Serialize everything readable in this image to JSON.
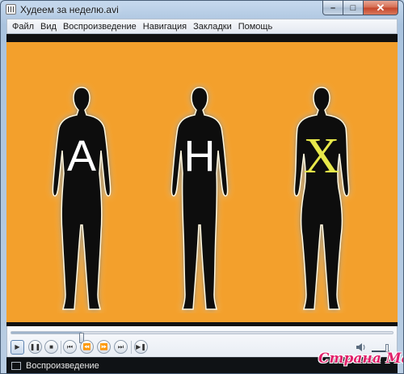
{
  "window": {
    "title": "Худеем за неделю.avi"
  },
  "menu": {
    "items": [
      {
        "label": "Файл"
      },
      {
        "label": "Вид"
      },
      {
        "label": "Воспроизведение"
      },
      {
        "label": "Навигация"
      },
      {
        "label": "Закладки"
      },
      {
        "label": "Помощь"
      }
    ]
  },
  "video": {
    "background": "#f3a02c",
    "letters": [
      {
        "text": "А",
        "color": "#ffffff"
      },
      {
        "text": "Н",
        "color": "#ffffff"
      },
      {
        "text": "Х",
        "color": "#e7e84a"
      }
    ]
  },
  "playback": {
    "seek_position": 0.185,
    "volume_level": 0.85
  },
  "status": {
    "text": "Воспроизведение"
  },
  "watermark": {
    "text": "Страна Мам"
  }
}
